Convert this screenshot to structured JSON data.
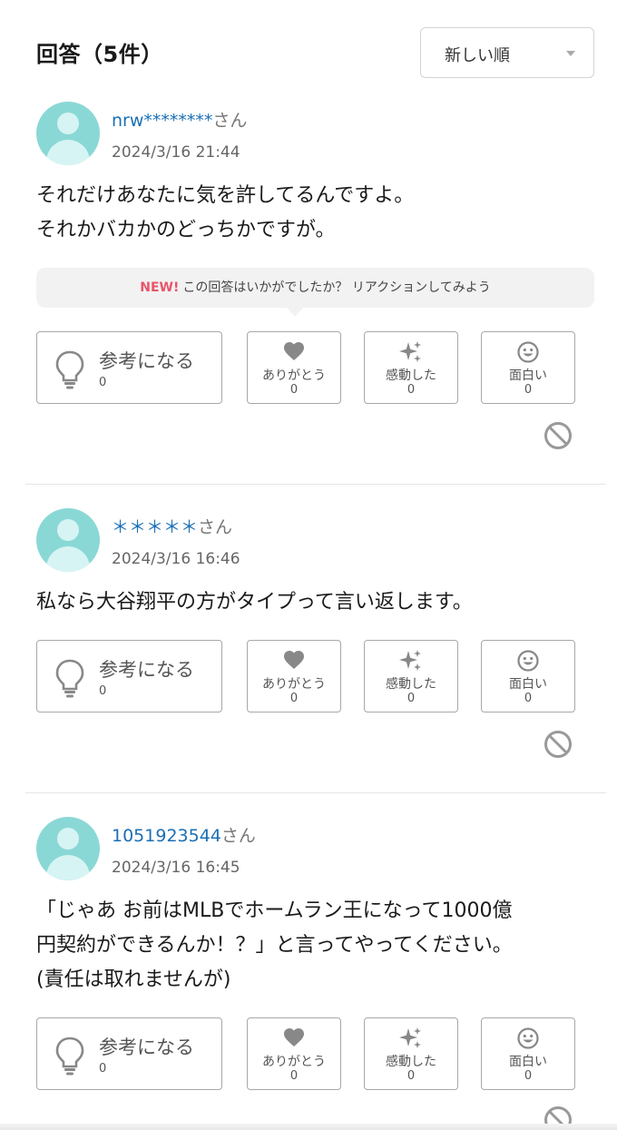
{
  "header": {
    "title": "回答（5件）",
    "sort": {
      "selected": "新しい順"
    }
  },
  "answers": [
    {
      "user": "nrw********",
      "honorific": "さん",
      "date": "2024/3/16 21:44",
      "lines": [
        "それだけあなたに気を許してるんですよ。",
        "それかバカかのどっちかですが。"
      ],
      "reactions": {
        "helpful_label": "参考になる",
        "helpful_count": "0",
        "thanks_label": "ありがとう",
        "thanks_count": "0",
        "moved_label": "感動した",
        "moved_count": "0",
        "funny_label": "面白い",
        "funny_count": "0"
      }
    },
    {
      "user": "＊＊＊＊＊",
      "honorific": "さん",
      "date": "2024/3/16 16:46",
      "lines": [
        "私なら大谷翔平の方がタイプって言い返します。"
      ],
      "reactions": {
        "helpful_label": "参考になる",
        "helpful_count": "0",
        "thanks_label": "ありがとう",
        "thanks_count": "0",
        "moved_label": "感動した",
        "moved_count": "0",
        "funny_label": "面白い",
        "funny_count": "0"
      }
    },
    {
      "user": "1051923544",
      "honorific": "さん",
      "date": "2024/3/16 16:45",
      "lines": [
        "「じゃあ お前はMLBでホームラン王になって1000億",
        "円契約ができるんか！？」と言ってやってください。",
        "(責任は取れませんが)"
      ],
      "reactions": {
        "helpful_label": "参考になる",
        "helpful_count": "0",
        "thanks_label": "ありがとう",
        "thanks_count": "0",
        "moved_label": "感動した",
        "moved_count": "0",
        "funny_label": "面白い",
        "funny_count": "0"
      }
    }
  ],
  "promo": {
    "badge": "NEW!",
    "text": "この回答はいかがでしたか？ リアクションしてみよう"
  },
  "colors": {
    "username": "#1a6fb5",
    "avatar": "#8ad8d6",
    "new_badge": "#e8556a",
    "border": "#a8a8a8"
  },
  "icons": {
    "helpful": "lightbulb-icon",
    "thanks": "heart-icon",
    "moved": "sparkle-icon",
    "funny": "smile-icon",
    "block": "block-icon",
    "sort": "chevron-down-icon"
  }
}
